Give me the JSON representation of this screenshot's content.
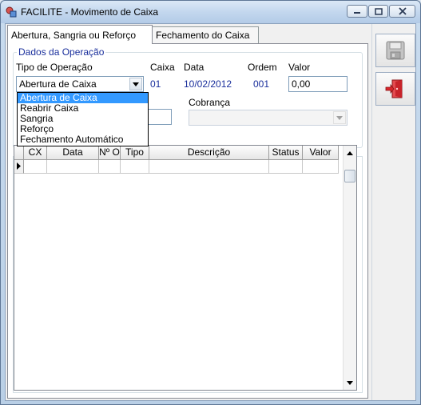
{
  "window": {
    "title": "FACILITE - Movimento de Caixa",
    "icons": {
      "app": "app-icon",
      "minimize": "minimize-icon",
      "maximize": "maximize-icon",
      "close": "close-icon"
    }
  },
  "tabs": [
    {
      "label": "Abertura, Sangria ou Reforço",
      "active": true
    },
    {
      "label": "Fechamento do Caixa",
      "active": false
    }
  ],
  "operation_group": {
    "legend": "Dados da Operação",
    "tipo_label": "Tipo de Operação",
    "tipo_value": "Abertura de Caixa",
    "caixa_label": "Caixa",
    "caixa_value": "01",
    "data_label": "Data",
    "data_value": "10/02/2012",
    "ordem_label": "Ordem",
    "ordem_value": "001",
    "valor_label": "Valor",
    "valor_value": "0,00",
    "cobranca_label": "Cobrança",
    "cobranca_value": ""
  },
  "dropdown_options": [
    {
      "label": "Abertura de Caixa",
      "selected": true
    },
    {
      "label": "Reabrir Caixa",
      "selected": false
    },
    {
      "label": "Sangria",
      "selected": false
    },
    {
      "label": "Reforço",
      "selected": false
    },
    {
      "label": "Fechamento Automático",
      "selected": false
    }
  ],
  "grid": {
    "columns": [
      "CX",
      "Data",
      "Nº O",
      "Tipo",
      "Descrição",
      "Status",
      "Valor"
    ],
    "rows": [
      [
        "",
        "",
        "",
        "",
        "",
        "",
        ""
      ]
    ]
  },
  "toolbar": {
    "save_icon": "floppy-disk-icon",
    "exit_icon": "exit-door-icon"
  },
  "colors": {
    "accent_blue": "#1a2f9c",
    "selection": "#3399ff",
    "exit_red": "#d8262b"
  }
}
